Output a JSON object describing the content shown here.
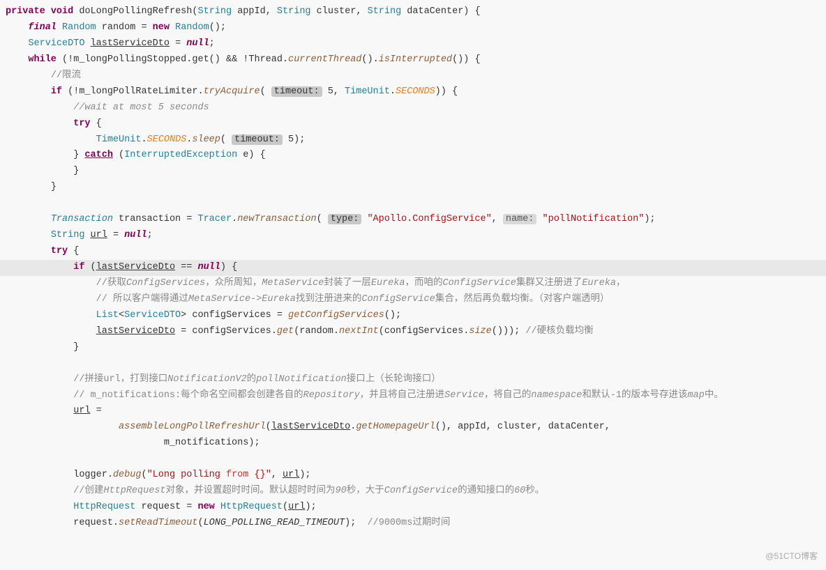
{
  "watermark": "@51CTO博客",
  "code": {
    "lines": [
      {
        "id": 1,
        "highlighted": false
      },
      {
        "id": 2,
        "highlighted": false
      },
      {
        "id": 3,
        "highlighted": false
      },
      {
        "id": 4,
        "highlighted": false
      },
      {
        "id": 5,
        "highlighted": false
      },
      {
        "id": 6,
        "highlighted": false
      },
      {
        "id": 7,
        "highlighted": false
      },
      {
        "id": 8,
        "highlighted": false
      },
      {
        "id": 9,
        "highlighted": false
      },
      {
        "id": 10,
        "highlighted": false
      },
      {
        "id": 11,
        "highlighted": false
      },
      {
        "id": 12,
        "highlighted": false
      },
      {
        "id": 13,
        "highlighted": true
      },
      {
        "id": 14,
        "highlighted": false
      },
      {
        "id": 15,
        "highlighted": false
      }
    ]
  }
}
